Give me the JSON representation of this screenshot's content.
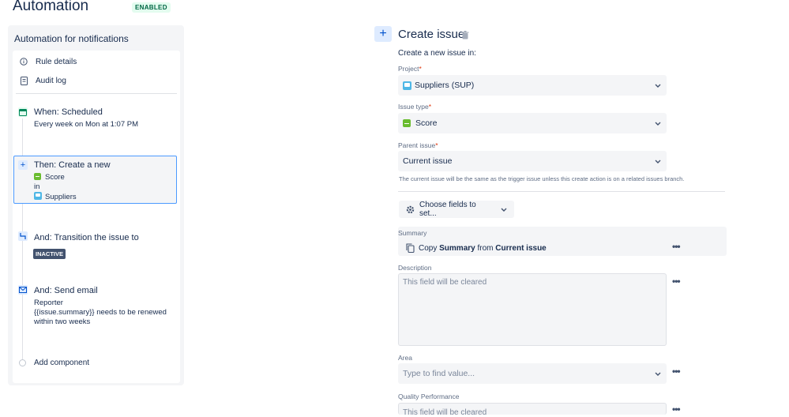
{
  "header": {
    "title": "Automation",
    "status": "ENABLED"
  },
  "rule": {
    "name": "Automation for notifications",
    "menu": [
      {
        "label": "Rule details",
        "icon": "info-icon"
      },
      {
        "label": "Audit log",
        "icon": "document-icon"
      }
    ],
    "steps": {
      "trigger": {
        "title": "When: Scheduled",
        "detail": "Every week on Mon at 1:07 PM"
      },
      "create": {
        "title": "Then: Create a new",
        "issue_type": "Score",
        "in": "in",
        "project": "Suppliers"
      },
      "transition": {
        "title": "And: Transition the issue to",
        "status": "INACTIVE"
      },
      "email": {
        "title": "And: Send email",
        "line1": "Reporter",
        "line2": "{{issue.summary}} needs to be renewed",
        "line3": "within two weeks"
      },
      "add": {
        "label": "Add component"
      }
    }
  },
  "editor": {
    "title": "Create issue",
    "subtitle": "Create a new issue in:",
    "project": {
      "label": "Project",
      "required": "*",
      "value": "Suppliers (SUP)"
    },
    "issue_type": {
      "label": "Issue type",
      "required": "*",
      "value": "Score"
    },
    "parent": {
      "label": "Parent issue",
      "required": "*",
      "value": "Current issue",
      "help": "The current issue will be the same as the trigger issue unless this create action is on a related issues branch."
    },
    "choose_fields": "Choose fields to set...",
    "summary": {
      "label": "Summary",
      "copy": "Copy",
      "field": "Summary",
      "from": "from",
      "source": "Current issue"
    },
    "description": {
      "label": "Description",
      "placeholder": "This field will be cleared"
    },
    "area": {
      "label": "Area",
      "placeholder": "Type to find value..."
    },
    "quality": {
      "label": "Quality Performance",
      "placeholder": "This field will be cleared"
    }
  },
  "colors": {
    "accent": "#0052cc",
    "selected_border": "#4c9aff",
    "enabled_bg": "#e3fcef",
    "enabled_text": "#006644"
  }
}
